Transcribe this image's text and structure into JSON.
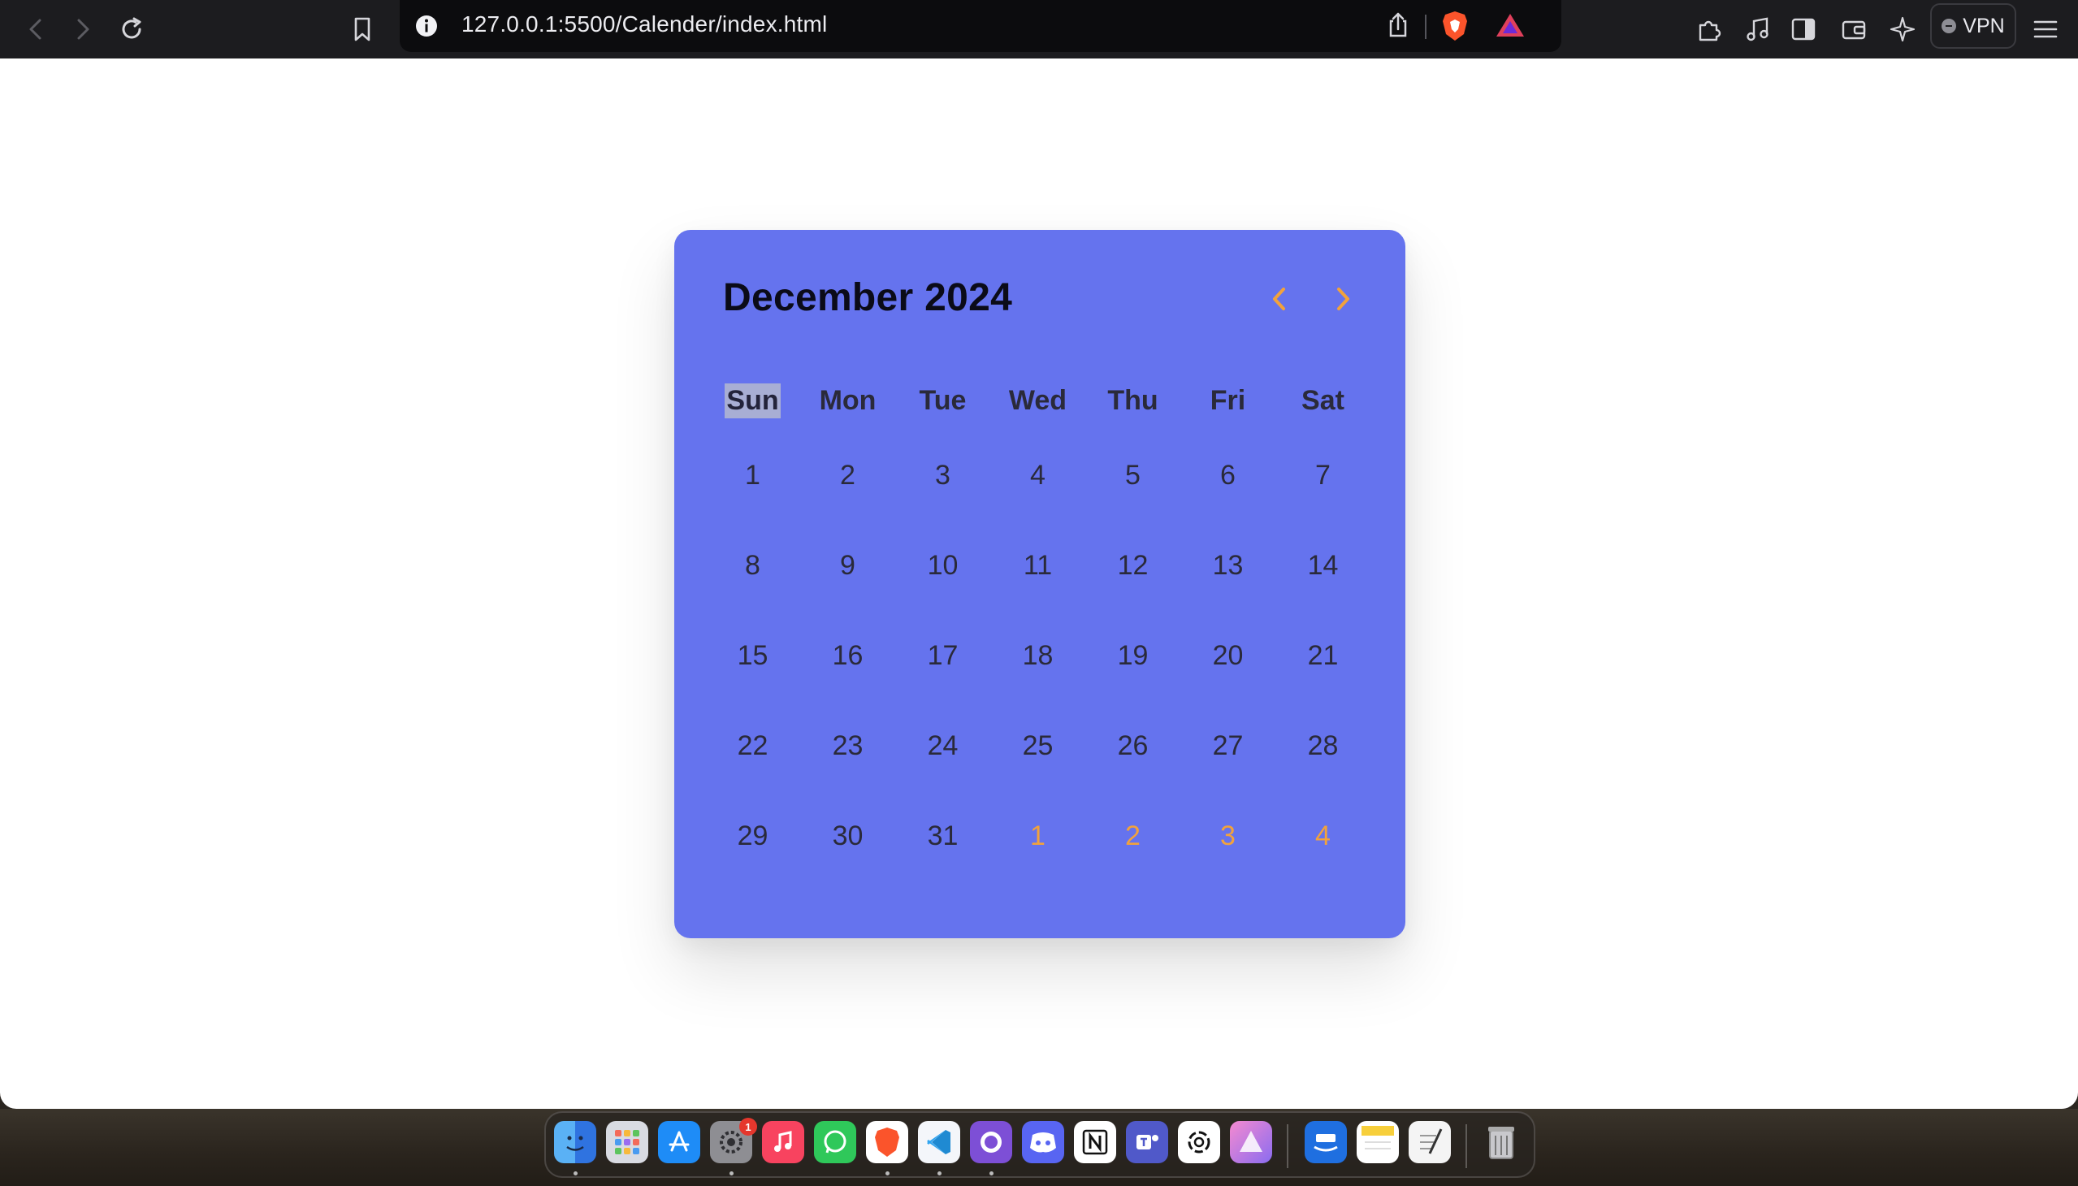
{
  "browser": {
    "url": "127.0.0.1:5500/Calender/index.html",
    "vpn_label": "VPN"
  },
  "calendar": {
    "title": "December 2024",
    "weekdays": [
      "Sun",
      "Mon",
      "Tue",
      "Wed",
      "Thu",
      "Fri",
      "Sat"
    ],
    "selected_weekday": "Sun",
    "weeks": [
      [
        {
          "d": "1"
        },
        {
          "d": "2"
        },
        {
          "d": "3"
        },
        {
          "d": "4"
        },
        {
          "d": "5"
        },
        {
          "d": "6"
        },
        {
          "d": "7"
        }
      ],
      [
        {
          "d": "8"
        },
        {
          "d": "9"
        },
        {
          "d": "10"
        },
        {
          "d": "11"
        },
        {
          "d": "12"
        },
        {
          "d": "13"
        },
        {
          "d": "14"
        }
      ],
      [
        {
          "d": "15"
        },
        {
          "d": "16"
        },
        {
          "d": "17"
        },
        {
          "d": "18"
        },
        {
          "d": "19"
        },
        {
          "d": "20"
        },
        {
          "d": "21"
        }
      ],
      [
        {
          "d": "22"
        },
        {
          "d": "23"
        },
        {
          "d": "24"
        },
        {
          "d": "25"
        },
        {
          "d": "26"
        },
        {
          "d": "27"
        },
        {
          "d": "28"
        }
      ],
      [
        {
          "d": "29"
        },
        {
          "d": "30"
        },
        {
          "d": "31"
        },
        {
          "d": "1",
          "next": true
        },
        {
          "d": "2",
          "next": true
        },
        {
          "d": "3",
          "next": true
        },
        {
          "d": "4",
          "next": true
        }
      ]
    ],
    "colors": {
      "background": "#6573ee",
      "text": "#2a2a3a",
      "accent": "#f2a23c"
    }
  },
  "dock": {
    "apps": [
      "Finder",
      "Launchpad",
      "App Store",
      "System Settings",
      "Music",
      "WhatsApp",
      "Brave",
      "VS Code",
      "GitHub Desktop",
      "Discord",
      "Notion",
      "Teams",
      "ChatGPT",
      "Affinity",
      "Prime Video",
      "Notes",
      "TextEdit",
      "Trash"
    ],
    "settings_badge": "1"
  }
}
